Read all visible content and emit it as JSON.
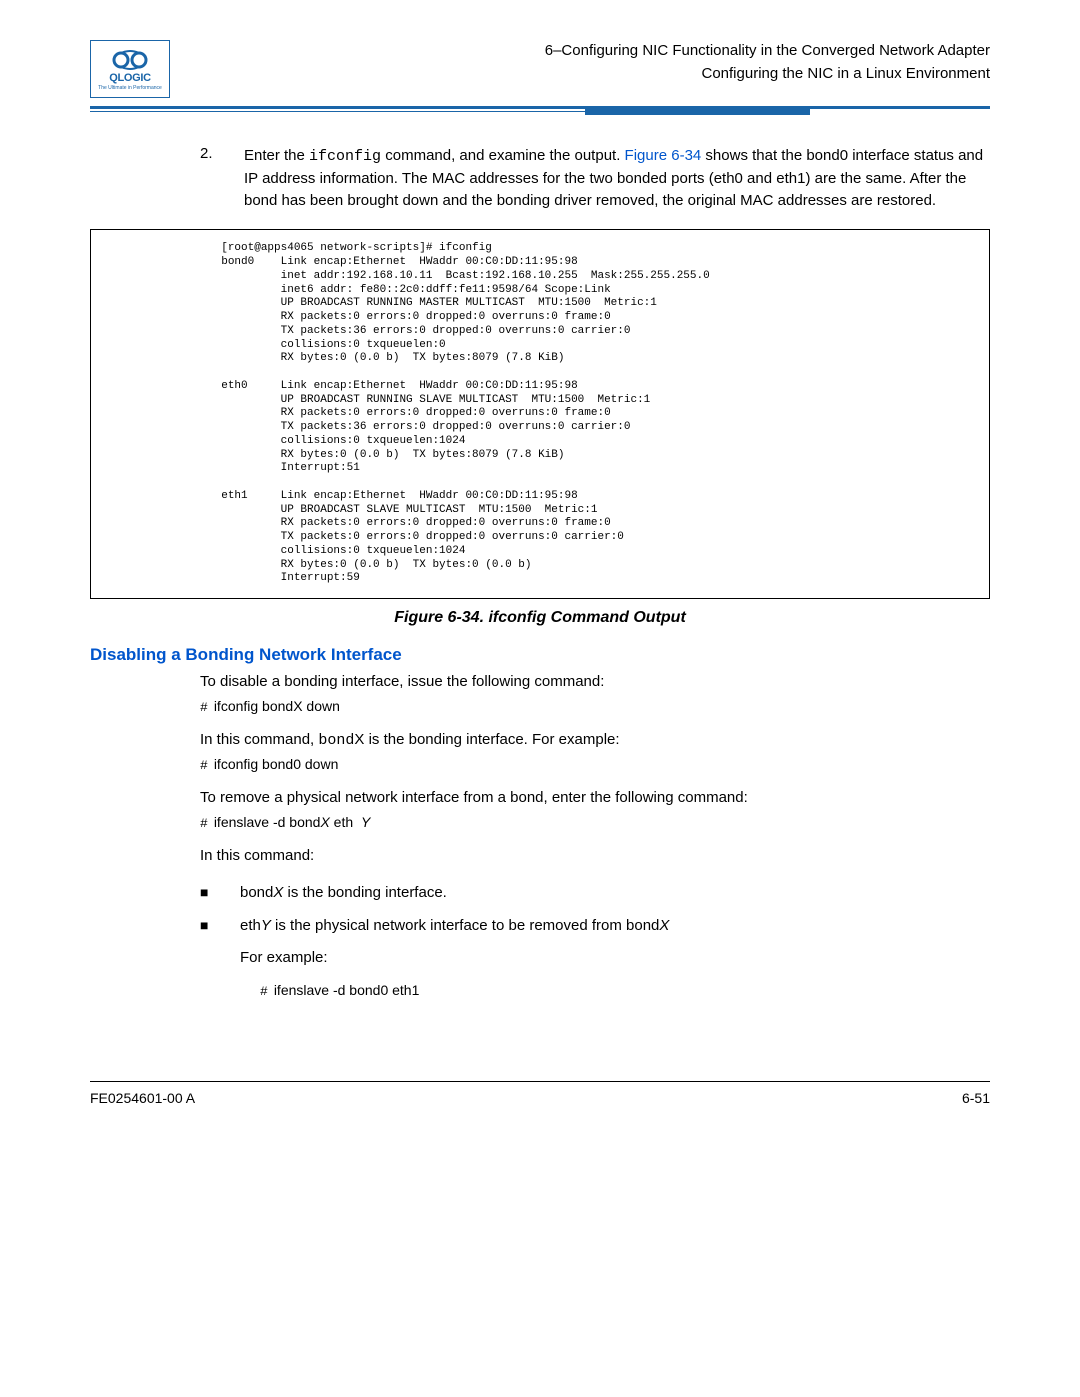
{
  "logo": {
    "name": "QLOGIC",
    "tagline": "The Ultimate in Performance"
  },
  "header": {
    "line1": "6–Configuring NIC Functionality in the Converged Network Adapter",
    "line2": "Configuring the NIC in a Linux Environment"
  },
  "step2": {
    "num": "2.",
    "pre": "Enter the ",
    "cmd": "ifconfig",
    "mid": " command, and examine the output. ",
    "link": "Figure 6-34",
    "post": " shows that the bond0 interface status and IP address information. The MAC addresses for the two bonded ports (eth0 and eth1) are the same. After the bond has been brought down and the bonding driver removed, the original MAC addresses are restored."
  },
  "figure": {
    "prompt": "[root@apps4065 network-scripts]# ifconfig",
    "ifaces": [
      {
        "name": "bond0",
        "lines": [
          "Link encap:Ethernet  HWaddr 00:C0:DD:11:95:98",
          "inet addr:192.168.10.11  Bcast:192.168.10.255  Mask:255.255.255.0",
          "inet6 addr: fe80::2c0:ddff:fe11:9598/64 Scope:Link",
          "UP BROADCAST RUNNING MASTER MULTICAST  MTU:1500  Metric:1",
          "RX packets:0 errors:0 dropped:0 overruns:0 frame:0",
          "TX packets:36 errors:0 dropped:0 overruns:0 carrier:0",
          "collisions:0 txqueuelen:0",
          "RX bytes:0 (0.0 b)  TX bytes:8079 (7.8 KiB)"
        ]
      },
      {
        "name": "eth0",
        "lines": [
          "Link encap:Ethernet  HWaddr 00:C0:DD:11:95:98",
          "UP BROADCAST RUNNING SLAVE MULTICAST  MTU:1500  Metric:1",
          "RX packets:0 errors:0 dropped:0 overruns:0 frame:0",
          "TX packets:36 errors:0 dropped:0 overruns:0 carrier:0",
          "collisions:0 txqueuelen:1024",
          "RX bytes:0 (0.0 b)  TX bytes:8079 (7.8 KiB)",
          "Interrupt:51"
        ]
      },
      {
        "name": "eth1",
        "lines": [
          "Link encap:Ethernet  HWaddr 00:C0:DD:11:95:98",
          "UP BROADCAST SLAVE MULTICAST  MTU:1500  Metric:1",
          "RX packets:0 errors:0 dropped:0 overruns:0 frame:0",
          "TX packets:0 errors:0 dropped:0 overruns:0 carrier:0",
          "collisions:0 txqueuelen:1024",
          "RX bytes:0 (0.0 b)  TX bytes:0 (0.0 b)",
          "Interrupt:59"
        ]
      }
    ]
  },
  "figure_caption": "Figure 6-34. ifconfig Command Output",
  "section_heading": "Disabling a Bonding Network Interface",
  "disable": {
    "intro": "To disable a bonding interface, issue the following command:",
    "cmd1_hash": "#",
    "cmd1": "ifconfig bondX down",
    "explain_pre": "In this command, ",
    "explain_mono": "bond",
    "explain_post": "X is the bonding interface. For example:",
    "cmd2_hash": "#",
    "cmd2": "ifconfig bond0 down",
    "remove_intro": "To remove a physical network interface from a bond, enter the following command:",
    "cmd3_hash": "#",
    "cmd3_a": "ifenslave -d bond",
    "cmd3_x": "X",
    "cmd3_b": " eth",
    "cmd3_y": "Y",
    "inthis": "In this command:",
    "bullets": [
      {
        "pre": "bond",
        "var": "X",
        "post": " is the bonding interface."
      },
      {
        "pre": "eth",
        "var": "Y",
        "post": " is the physical network interface to be removed from bond",
        "var2": "X"
      }
    ],
    "forexample": "For example:",
    "cmd4_hash": "#",
    "cmd4": "ifenslave -d bond0 eth1"
  },
  "footer": {
    "left": "FE0254601-00 A",
    "right": "6-51"
  }
}
